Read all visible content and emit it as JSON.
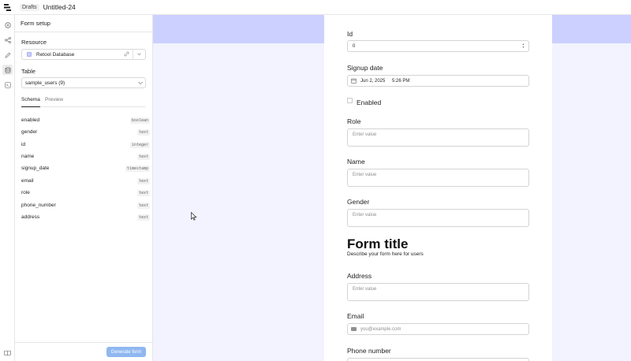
{
  "topbar": {
    "crumb": "Drafts",
    "title": "Untitled-24"
  },
  "rail": {
    "icons": [
      "plus-circle-icon",
      "share-nodes-icon",
      "pencil-icon",
      "database-icon",
      "code-icon",
      "book-icon"
    ]
  },
  "panel": {
    "header": "Form setup",
    "resource_label": "Resource",
    "resource_value": "Retool Database",
    "table_label": "Table",
    "table_value": "sample_users (9)",
    "tabs": [
      "Schema",
      "Preview"
    ],
    "schema": [
      {
        "name": "enabled",
        "type": "boolean"
      },
      {
        "name": "gender",
        "type": "text"
      },
      {
        "name": "id",
        "type": "integer"
      },
      {
        "name": "name",
        "type": "text"
      },
      {
        "name": "signup_date",
        "type": "timestamp"
      },
      {
        "name": "email",
        "type": "text"
      },
      {
        "name": "role",
        "type": "text"
      },
      {
        "name": "phone_number",
        "type": "text"
      },
      {
        "name": "address",
        "type": "text"
      }
    ],
    "generate_label": "Generate form"
  },
  "form": {
    "id_label": "Id",
    "id_value": "0",
    "signup_label": "Signup date",
    "signup_date": "Jun 2, 2025",
    "signup_time": "5:26 PM",
    "enabled_label": "Enabled",
    "role_label": "Role",
    "role_placeholder": "Enter value",
    "name_label": "Name",
    "name_placeholder": "Enter value",
    "gender_label": "Gender",
    "gender_placeholder": "Enter value",
    "title": "Form title",
    "description": "Describe your form here for users",
    "address_label": "Address",
    "address_placeholder": "Enter value",
    "email_label": "Email",
    "email_placeholder": "you@example.com",
    "phone_label": "Phone number"
  },
  "colors": {
    "canvas_bg": "#f2f3ff",
    "band": "#ccd0ff",
    "button": "#8fb7f0",
    "resource_square": "#c7cdfb"
  }
}
